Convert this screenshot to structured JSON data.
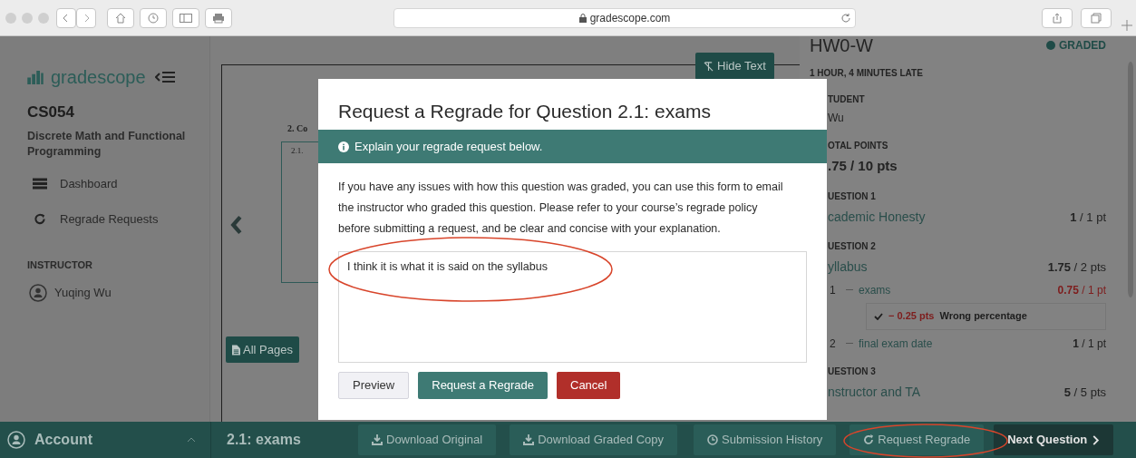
{
  "browser": {
    "address": "gradescope.com"
  },
  "sidebar": {
    "logo": "gradescope",
    "course_code": "CS054",
    "course_name": "Discrete Math and Functional Programming",
    "nav": [
      {
        "label": "Dashboard"
      },
      {
        "label": "Regrade Requests"
      }
    ],
    "section": "INSTRUCTOR",
    "instructor": "Yuqing Wu"
  },
  "document": {
    "hide_text": "Hide Text",
    "heading": "2. Co",
    "subheading": "2.1.",
    "all_pages": "All Pages"
  },
  "modal": {
    "title": "Request a Regrade for Question 2.1: exams",
    "notice": "Explain your regrade request below.",
    "description": "If you have any issues with how this question was graded, you can use this form to email the instructor who graded this question. Please refer to your course’s regrade policy before submitting a request, and be clear and concise with your explanation.",
    "answer": "I think it is what it is said on the syllabus",
    "buttons": [
      {
        "label": "Preview",
        "kind": "default"
      },
      {
        "label": "Request a Regrade",
        "kind": "primary"
      },
      {
        "label": "Cancel",
        "kind": "danger"
      }
    ]
  },
  "submission": {
    "title": "HW0-W",
    "status": "GRADED",
    "late": "1 HOUR, 4 MINUTES LATE",
    "lines": [
      {
        "kind": "label",
        "text": "TUDENT"
      },
      {
        "kind": "value",
        "text": "Wu"
      },
      {
        "kind": "label",
        "text": "OTAL POINTS"
      },
      {
        "kind": "total",
        "text": ".75 / 10 pts"
      },
      {
        "kind": "label",
        "text": "UESTION 1"
      },
      {
        "kind": "question",
        "text": "cademic Honesty",
        "score": "**1** / 1 pt",
        "deducted": false
      },
      {
        "kind": "label",
        "text": "UESTION 2"
      },
      {
        "kind": "question",
        "text": "yllabus",
        "score": "**1.75** / 2 pts",
        "deducted": false
      },
      {
        "kind": "subquestion",
        "number": "1",
        "text": "exams",
        "score": "**0.75** / 1 pt",
        "deducted": true
      },
      {
        "kind": "rubric",
        "checked": true,
        "points": "− 0.25 pts",
        "text": "Wrong percentage"
      },
      {
        "kind": "subquestion",
        "number": "2",
        "text": "final exam date",
        "score": "**1** / 1 pt",
        "deducted": false
      },
      {
        "kind": "label",
        "text": "UESTION 3"
      },
      {
        "kind": "question",
        "text": "nstructor and TA",
        "score": "**5** / 5 pts",
        "deducted": false
      }
    ]
  },
  "bottom_bar": {
    "account": "Account",
    "question": "2.1: exams",
    "actions": [
      {
        "label": "Download Original",
        "kind": "default"
      },
      {
        "label": "Download Graded Copy",
        "kind": "default"
      },
      {
        "label": "Submission History",
        "kind": "default"
      },
      {
        "label": "Request Regrade",
        "kind": "default"
      },
      {
        "label": "Next Question",
        "kind": "primary"
      }
    ]
  }
}
